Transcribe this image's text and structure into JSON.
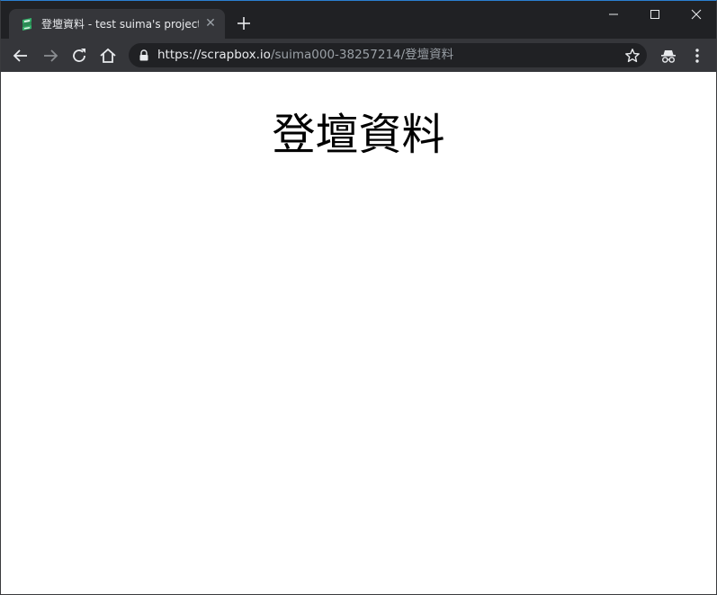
{
  "browser": {
    "tab": {
      "title": "登壇資料 - test suima's project",
      "close_glyph": "✕"
    },
    "address_bar": {
      "host": "https://scrapbox.io",
      "path": "/suima000-38257214/登壇資料"
    }
  },
  "page": {
    "title": "登壇資料"
  },
  "colors": {
    "tabstrip_bg": "#202124",
    "toolbar_bg": "#35363a",
    "omnibox_bg": "#202124",
    "favicon_green": "#37b26c"
  },
  "icons": {
    "favicon": "scrapbox-favicon-icon",
    "new_tab": "plus-icon",
    "minimize": "minimize-icon",
    "maximize": "maximize-icon",
    "close_window": "close-icon",
    "back": "arrow-left-icon",
    "forward": "arrow-right-icon",
    "reload": "reload-icon",
    "home": "home-icon",
    "lock": "lock-icon",
    "bookmark": "star-icon",
    "incognito": "incognito-icon",
    "menu": "kebab-menu-icon"
  }
}
